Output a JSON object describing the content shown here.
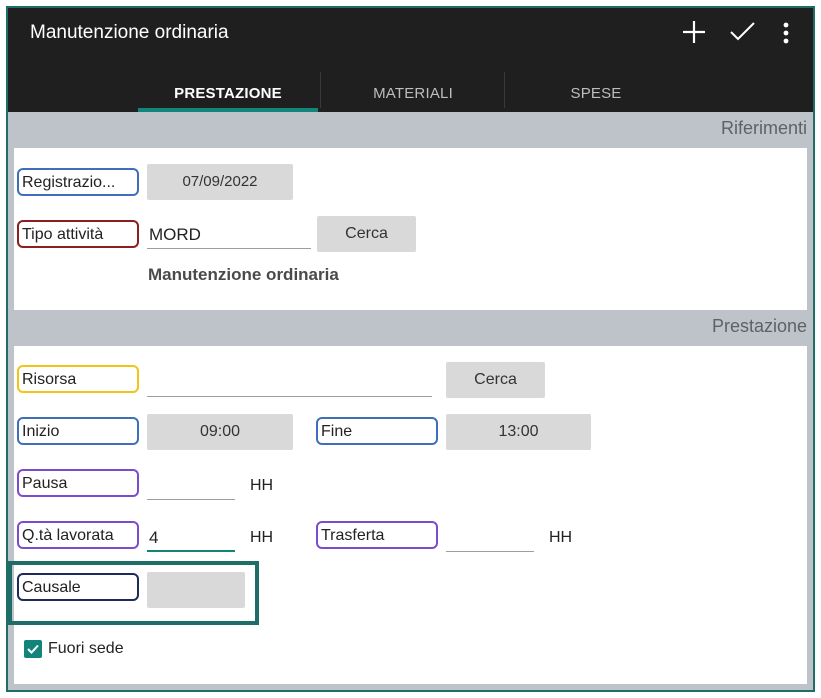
{
  "appbar": {
    "title": "Manutenzione ordinaria",
    "icons": [
      "add-icon",
      "check-icon",
      "more-vert-icon"
    ]
  },
  "tabs": [
    {
      "label": "PRESTAZIONE",
      "active": true
    },
    {
      "label": "MATERIALI",
      "active": false
    },
    {
      "label": "SPESE",
      "active": false
    }
  ],
  "riferimenti": {
    "header": "Riferimenti",
    "registrazione_label": "Registrazio...",
    "registrazione_value": "07/09/2022",
    "tipo_label": "Tipo attività",
    "tipo_value": "MORD",
    "cerca_label": "Cerca",
    "tipo_desc": "Manutenzione ordinaria"
  },
  "prestazione": {
    "header": "Prestazione",
    "risorsa_label": "Risorsa",
    "risorsa_value": "",
    "cerca_label": "Cerca",
    "inizio_label": "Inizio",
    "inizio_value": "09:00",
    "fine_label": "Fine",
    "fine_value": "13:00",
    "pausa_label": "Pausa",
    "pausa_value": "",
    "pausa_unit": "HH",
    "qta_label": "Q.tà lavorata",
    "qta_value": "4",
    "qta_unit": "HH",
    "trasferta_label": "Trasferta",
    "trasferta_value": "",
    "trasferta_unit": "HH",
    "causale_label": "Causale",
    "causale_value": "",
    "fuori_sede_label": "Fuori sede",
    "fuori_sede_checked": true
  },
  "colors": {
    "appbar": "#1f1f1f",
    "accent": "#13847a",
    "section_bg": "#bdc3c8",
    "border_blue": "#3f6fb8",
    "border_red": "#8b1e1e",
    "border_yellow": "#f2c418",
    "border_purple": "#7c4ccf",
    "border_navy": "#1e2a5a",
    "highlight": "#1e6d66"
  }
}
